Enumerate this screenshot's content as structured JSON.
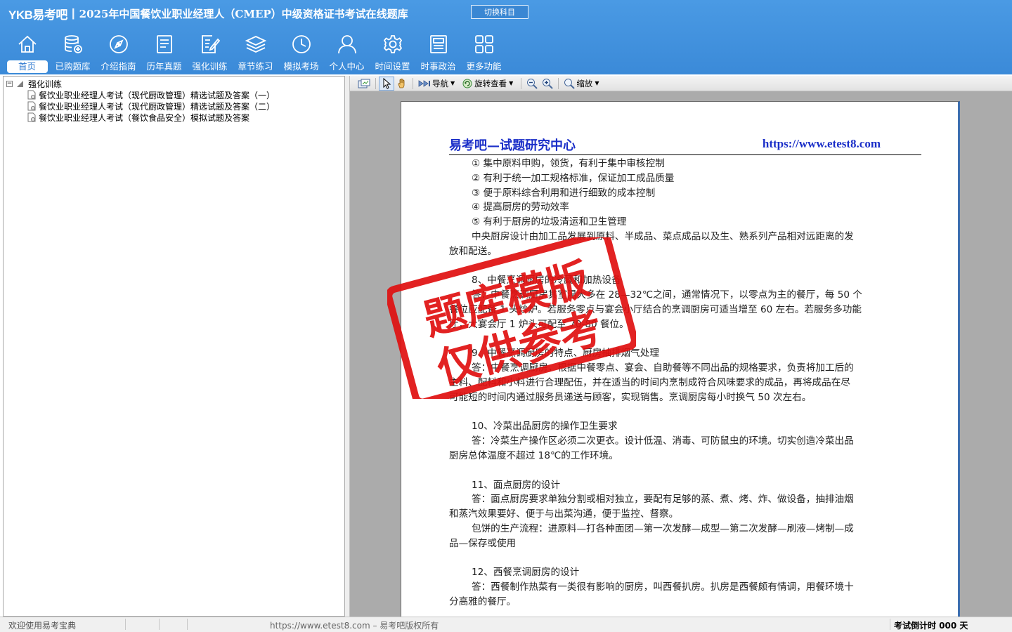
{
  "header": {
    "logo": "YKB易考吧",
    "title": "2025年中国餐饮业职业经理人（CMEP）中级资格证书考试在线题库",
    "switch_button": "切换科目"
  },
  "nav": {
    "items": [
      {
        "label": "首页",
        "icon": "home-icon"
      },
      {
        "label": "已购题库",
        "icon": "database-icon"
      },
      {
        "label": "介绍指南",
        "icon": "compass-icon"
      },
      {
        "label": "历年真题",
        "icon": "list-document-icon"
      },
      {
        "label": "强化训练",
        "icon": "edit-document-icon"
      },
      {
        "label": "章节练习",
        "icon": "layers-icon"
      },
      {
        "label": "模拟考场",
        "icon": "clock-icon"
      },
      {
        "label": "个人中心",
        "icon": "user-icon"
      },
      {
        "label": "时间设置",
        "icon": "gear-icon"
      },
      {
        "label": "时事政治",
        "icon": "newspaper-icon"
      },
      {
        "label": "更多功能",
        "icon": "grid-icon"
      }
    ]
  },
  "tree": {
    "root": "强化训练",
    "items": [
      "餐饮业职业经理人考试（现代厨政管理）精选试题及答案（一）",
      "餐饮业职业经理人考试（现代厨政管理）精选试题及答案（二）",
      "餐饮业职业经理人考试（餐饮食品安全）模拟试题及答案"
    ]
  },
  "toolbar": {
    "nav_label": "导航",
    "rotate_label": "旋转查看",
    "zoom_label": "缩放"
  },
  "document": {
    "brand": "易考吧—试题研究中心",
    "url": "https://www.etest8.com",
    "lines": [
      "① 集中原料申购，领货，有利于集中审核控制",
      "② 有利于统一加工规格标准，保证加工成品质量",
      "③ 便于原料综合利用和进行细致的成本控制",
      "④ 提高厨房的劳动效率",
      "⑤ 有利于厨房的垃圾清运和卫生管理",
      "中央厨房设计由加工品发展到原料、半成品、菜点成品以及生、熟系列产品相对远距离的发",
      "放和配送。",
      "",
      "8、中餐烹调厨房的冷藏和加热设备",
      "答：中餐烹调厨房其室温大多在 28—32℃之间，通常情况下，以零点为主的餐厅，每 50 个",
      "餐位应配备 1 头炒炉。若服务零点与宴会小厅结合的烹调厨房可适当增至 60 左右。若服务多功能",
      "厅，大宴会厅 1 炉头可配至 70-80 餐位。",
      "",
      "9、中餐烹调厨房的特点、厨房抽排烟气处理",
      "答：中餐烹调厨房，根据中餐零点、宴会、自助餐等不同出品的规格要求，负责将加工后的",
      "主料、配料和小料进行合理配伍，并在适当的时间内烹制成符合风味要求的成品，再将成品在尽",
      "可能短的时间内通过服务员递送与顾客，实现销售。烹调厨房每小时换气 50 次左右。",
      "",
      "10、冷菜出品厨房的操作卫生要求",
      "答：冷菜生产操作区必须二次更衣。设计低温、消毒、可防鼠虫的环境。切实创造冷菜出品",
      "厨房总体温度不超过 18℃的工作环境。",
      "",
      "11、面点厨房的设计",
      "答：面点厨房要求单独分割或相对独立，要配有足够的蒸、煮、烤、炸、做设备，抽排油烟",
      "和蒸汽效果要好、便于与出菜沟通，便于监控、督察。",
      "包饼的生产流程：进原料—打各种面团—第一次发酵—成型—第二次发酵—刷液—烤制—成",
      "品—保存或使用",
      "",
      "12、西餐烹调厨房的设计",
      "答：西餐制作热菜有一类很有影响的厨房，叫西餐扒房。扒房是西餐颇有情调，用餐环境十",
      "分高雅的餐厅。"
    ],
    "indent": [
      true,
      true,
      true,
      true,
      true,
      true,
      false,
      false,
      true,
      true,
      false,
      false,
      false,
      true,
      true,
      false,
      false,
      false,
      true,
      true,
      false,
      false,
      true,
      true,
      false,
      true,
      false,
      false,
      true,
      true,
      false
    ]
  },
  "stamp": {
    "line1": "题库模版",
    "line2": "仅供参考",
    "color": "#e01010"
  },
  "status": {
    "welcome": "欢迎使用易考宝典",
    "copyright": "https://www.etest8.com – 易考吧版权所有",
    "countdown": "考试倒计时 000 天"
  }
}
